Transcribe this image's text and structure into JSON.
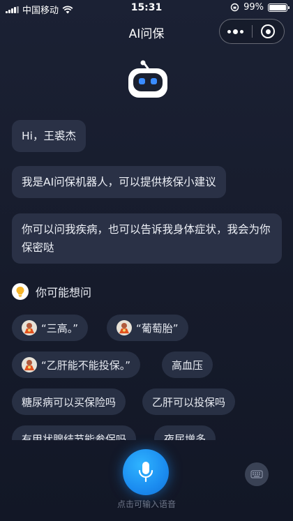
{
  "status_bar": {
    "carrier": "中国移动",
    "time": "15:31",
    "battery": "99%",
    "battery_level": 0.99
  },
  "nav": {
    "title": "AI问保"
  },
  "chat": {
    "messages": [
      {
        "text": "Hi，王裘杰"
      },
      {
        "text": "我是AI问保机器人，可以提供核保小建议"
      },
      {
        "text": "你可以问我疾病，也可以告诉我身体症状，我会为你保密哒"
      }
    ]
  },
  "suggestions": {
    "heading": "你可能想问",
    "chips": [
      {
        "label": "“三高。”",
        "has_avatar": true
      },
      {
        "label": "“葡萄胎”",
        "has_avatar": true
      },
      {
        "label": "“乙肝能不能投保。”",
        "has_avatar": true
      },
      {
        "label": "高血压",
        "has_avatar": false
      },
      {
        "label": "糖尿病可以买保险吗",
        "has_avatar": false
      },
      {
        "label": "乙肝可以投保吗",
        "has_avatar": false
      },
      {
        "label": "有甲状腺结节能参保吗",
        "has_avatar": false
      },
      {
        "label": "夜尿增多",
        "has_avatar": false
      }
    ]
  },
  "input": {
    "voice_hint": "点击可输入语音"
  },
  "icons": {
    "robot": "robot-icon",
    "bulb": "lightbulb-icon",
    "mic": "microphone-icon",
    "keyboard": "keyboard-icon",
    "more": "more-dots-icon",
    "close": "target-close-icon"
  },
  "colors": {
    "accent": "#1b8cf0",
    "bubble": "#2a3146",
    "background": "#1b2134"
  }
}
